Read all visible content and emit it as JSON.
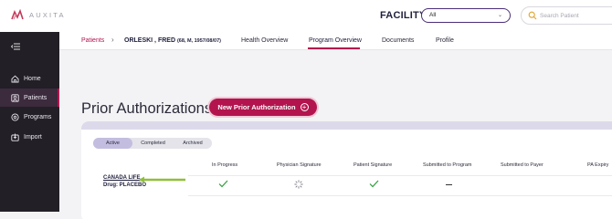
{
  "app": {
    "logo_text": "AUXITA"
  },
  "header": {
    "facility_label": "FACILITY",
    "facility_value": "All",
    "search_placeholder": "Search Patient"
  },
  "sidebar": {
    "items": [
      {
        "label": "Home",
        "icon": "home-icon"
      },
      {
        "label": "Patients",
        "icon": "patients-icon",
        "active": true
      },
      {
        "label": "Programs",
        "icon": "programs-icon"
      },
      {
        "label": "Import",
        "icon": "import-icon"
      }
    ]
  },
  "breadcrumb": {
    "root": "Patients",
    "patient_name": "ORLESKI , FRED",
    "patient_detail": "(68, M, 1957/08/07)"
  },
  "tabs": [
    {
      "label": "Health Overview"
    },
    {
      "label": "Program Overview",
      "active": true
    },
    {
      "label": "Documents"
    },
    {
      "label": "Profile"
    }
  ],
  "main": {
    "title": "Prior Authorizations",
    "new_button_label": "New Prior Authorization",
    "filters": [
      {
        "label": "Active",
        "active": true
      },
      {
        "label": "Completed"
      },
      {
        "label": "Archived"
      }
    ],
    "columns": [
      "In Progress",
      "Physician Signature",
      "Patient Signature",
      "Submitted to Program",
      "Submitted to Payer",
      "PA Expiry"
    ],
    "rows": [
      {
        "insurer": "CANADA LIFE",
        "drug": "Drug: PLACEBO",
        "in_progress": "check",
        "physician_signature": "pending",
        "patient_signature": "check",
        "submitted_to_program": "dash"
      }
    ]
  },
  "colors": {
    "accent": "#b3144e",
    "sidebar_bg": "#221f26",
    "check": "#2e9d3a",
    "arrow": "#8fbf3a"
  }
}
